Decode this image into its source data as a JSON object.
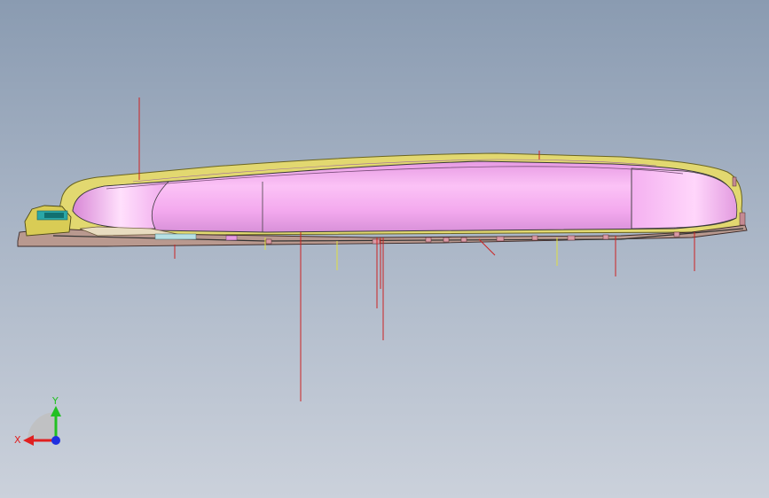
{
  "viewport": {
    "background_top": "#8a9bb1",
    "background_bottom": "#cbd1db"
  },
  "model": {
    "shell_color": "#f6aef0",
    "shell_highlight": "#ffd9fb",
    "outline_color": "#3a3a3a",
    "frame_color": "#e4d86a",
    "base_color": "#9c7a78",
    "board_color": "#c9b8c4",
    "connector_color": "#2aa7a7",
    "leader_line_color": "#cc2222",
    "yellow_line_color": "#e0e040"
  },
  "triad": {
    "x_label": "X",
    "y_label": "Y",
    "x_color": "#e02020",
    "y_color": "#22c022",
    "z_color": "#2030e0",
    "plane_color": "#c0c0c0"
  }
}
